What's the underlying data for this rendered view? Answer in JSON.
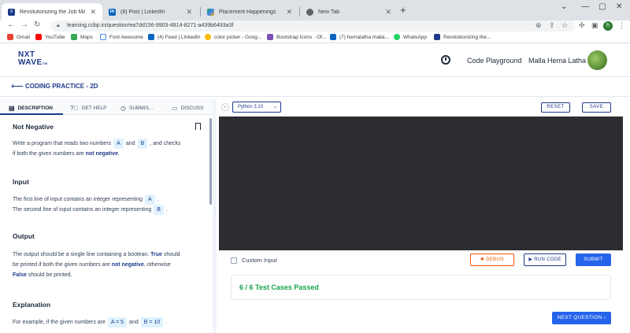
{
  "browser": {
    "tabs": [
      {
        "label": "Revolutionizing the Job Market |",
        "active": true,
        "icon": "ccbp-icon"
      },
      {
        "label": "(8) Post | LinkedIn",
        "active": false,
        "icon": "linkedin-icon"
      },
      {
        "label": "Placement Happenings",
        "active": false,
        "icon": "drive-icon"
      },
      {
        "label": "New Tab",
        "active": false,
        "icon": "chrome-icon"
      }
    ],
    "url": "learning.ccbp.in/question/ea7dd156-9903-4814-8271-a439b6493a3f",
    "profile_initial": "h",
    "bookmarks": [
      "Gmail",
      "YouTube",
      "Maps",
      "Font Awesome",
      "(4) Feed | LinkedIn",
      "color picker - Goog...",
      "Bootstrap Icons · Of...",
      "(7) hemalatha malla...",
      "WhatsApp",
      "Revolutionizing the..."
    ]
  },
  "header": {
    "logo_line1": "NXT",
    "logo_line2": "WAVE",
    "logo_tm": "TM",
    "code_playground": "Code Playground",
    "user_name": "Malla Hema Latha"
  },
  "practice": {
    "title": "CODING PRACTICE - 2D"
  },
  "left_tabs": {
    "description": "DESCRIPTION",
    "help": "GET HELP",
    "submissions": "SUBMIS...",
    "discuss": "DISCUSS"
  },
  "problem": {
    "title": "Not Negative",
    "intro_1": "Write a program that reads two numbers",
    "chip_a": "A",
    "and": "and",
    "chip_b": "B",
    "intro_2": ", and checks",
    "intro_3": "if both the given numbers are",
    "not_negative": "not negative",
    "period": ".",
    "input_heading": "Input",
    "input_1": "The first line of input contains an integer representing",
    "input_2": "The second line of input contains an integer representing",
    "output_heading": "Output",
    "output_1": "The output should be a single line containing a boolean.",
    "true_word": "True",
    "should": "should",
    "output_2": "be printed if both the given numbers are",
    "otherwise": ", otherwise",
    "false_word": "False",
    "output_3": "should be printed.",
    "explanation_heading": "Explanation",
    "expl_1": "For example, if the given numbers are",
    "chip_a5": "A = 5",
    "chip_b10": "B = 10"
  },
  "editor": {
    "language": "Python 3.10",
    "reset": "RESET",
    "save": "SAVE",
    "custom_input": "Custom Input",
    "debug": "DEBUG",
    "run": "RUN CODE",
    "submit": "SUBMIT",
    "result": "6 / 6 Test Cases Passed",
    "next": "NEXT QUESTION"
  }
}
